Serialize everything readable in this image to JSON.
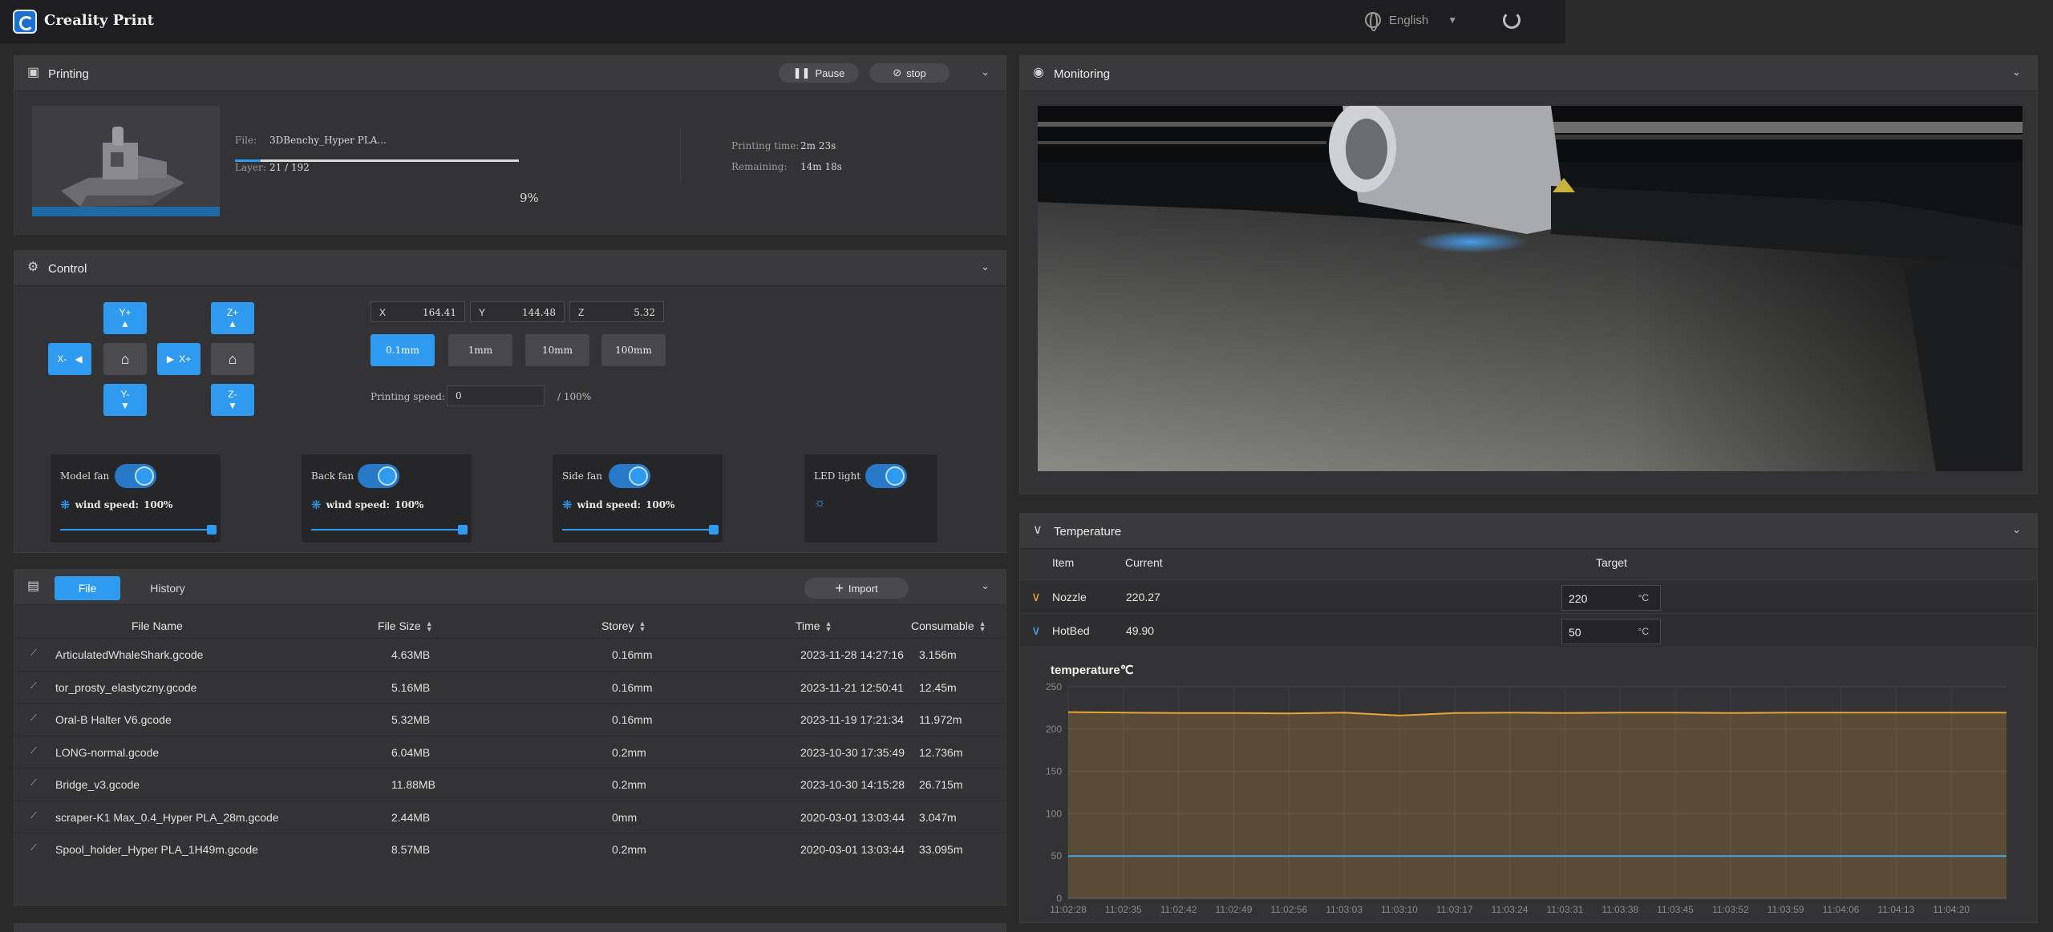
{
  "app": {
    "title": "Creality Print",
    "language": "English"
  },
  "printing": {
    "title": "Printing",
    "pause_label": "Pause",
    "stop_label": "stop",
    "file_label": "File:",
    "file_value": "3DBenchy_Hyper PLA...",
    "layer_label": "Layer:",
    "layer_value": "21 / 192",
    "progress_percent": 9,
    "progress_text": "9%",
    "time_label": "Printing time:",
    "time_value": "2m 23s",
    "remaining_label": "Remaining:",
    "remaining_value": "14m 18s"
  },
  "control": {
    "title": "Control",
    "jog": {
      "y_plus": "Y+",
      "y_minus": "Y-",
      "x_plus": "X+",
      "x_minus": "X-",
      "z_plus": "Z+",
      "z_minus": "Z-"
    },
    "coords": [
      {
        "axis": "X",
        "value": "164.41"
      },
      {
        "axis": "Y",
        "value": "144.48"
      },
      {
        "axis": "Z",
        "value": "5.32"
      }
    ],
    "steps": [
      "0.1mm",
      "1mm",
      "10mm",
      "100mm"
    ],
    "active_step": "0.1mm",
    "speed_label": "Printing speed:",
    "speed_value": "0",
    "speed_suffix": "/ 100%",
    "fans": [
      {
        "name": "Model fan",
        "ws_label": "wind speed:",
        "ws_value": "100%",
        "on": true
      },
      {
        "name": "Back fan",
        "ws_label": "wind speed:",
        "ws_value": "100%",
        "on": true
      },
      {
        "name": "Side fan",
        "ws_label": "wind speed:",
        "ws_value": "100%",
        "on": true
      }
    ],
    "led": {
      "name": "LED light",
      "on": true
    }
  },
  "files": {
    "tab_file": "File",
    "tab_history": "History",
    "import_label": "Import",
    "columns": {
      "name": "File Name",
      "size": "File Size",
      "storey": "Storey",
      "time": "Time",
      "consumable": "Consumable"
    },
    "rows": [
      {
        "name": "ArticulatedWhaleShark.gcode",
        "size": "4.63MB",
        "storey": "0.16mm",
        "time": "2023-11-28 14:27:16",
        "consumable": "3.156m"
      },
      {
        "name": "tor_prosty_elastyczny.gcode",
        "size": "5.16MB",
        "storey": "0.16mm",
        "time": "2023-11-21 12:50:41",
        "consumable": "12.45m"
      },
      {
        "name": "Oral-B Halter V6.gcode",
        "size": "5.32MB",
        "storey": "0.16mm",
        "time": "2023-11-19 17:21:34",
        "consumable": "11.972m"
      },
      {
        "name": "LONG-normal.gcode",
        "size": "6.04MB",
        "storey": "0.2mm",
        "time": "2023-10-30 17:35:49",
        "consumable": "12.736m"
      },
      {
        "name": "Bridge_v3.gcode",
        "size": "11.88MB",
        "storey": "0.2mm",
        "time": "2023-10-30 14:15:28",
        "consumable": "26.715m"
      },
      {
        "name": "scraper-K1 Max_0.4_Hyper PLA_28m.gcode",
        "size": "2.44MB",
        "storey": "0mm",
        "time": "2020-03-01 13:03:44",
        "consumable": "3.047m"
      },
      {
        "name": "Spool_holder_Hyper PLA_1H49m.gcode",
        "size": "8.57MB",
        "storey": "0.2mm",
        "time": "2020-03-01 13:03:44",
        "consumable": "33.095m"
      }
    ]
  },
  "monitoring": {
    "title": "Monitoring"
  },
  "temperature": {
    "title": "Temperature",
    "columns": {
      "item": "Item",
      "current": "Current",
      "target": "Target"
    },
    "rows": [
      {
        "item": "Nozzle",
        "current": "220.27",
        "target": "220",
        "unit": "°C",
        "color": "#e8a33a"
      },
      {
        "item": "HotBed",
        "current": "49.90",
        "target": "50",
        "unit": "°C",
        "color": "#3aa7e8"
      }
    ]
  },
  "chart_data": {
    "type": "line",
    "title": "temperature℃",
    "x": [
      "11:02:28",
      "11:02:35",
      "11:02:42",
      "11:02:49",
      "11:02:56",
      "11:03:03",
      "11:03:10",
      "11:03:17",
      "11:03:24",
      "11:03:31",
      "11:03:38",
      "11:03:45",
      "11:03:52",
      "11:03:59",
      "11:04:06",
      "11:04:13",
      "11:04:20"
    ],
    "ylim": [
      0,
      250
    ],
    "yticks": [
      0,
      50,
      100,
      150,
      200,
      250
    ],
    "grid": true,
    "series": [
      {
        "color": "#e8a33a",
        "values": [
          220,
          219.5,
          219,
          219,
          218.5,
          219.5,
          216,
          219,
          219.5,
          219,
          219.5,
          219.5,
          219,
          219.5,
          219.5,
          219.5,
          219.5,
          219.5
        ],
        "fill": true
      },
      {
        "color": "#3aa7e8",
        "values": [
          50,
          50,
          50,
          50,
          50,
          50,
          50,
          50,
          50,
          50,
          50,
          50,
          50,
          50,
          50,
          50,
          50,
          50
        ],
        "fill": false
      }
    ]
  }
}
